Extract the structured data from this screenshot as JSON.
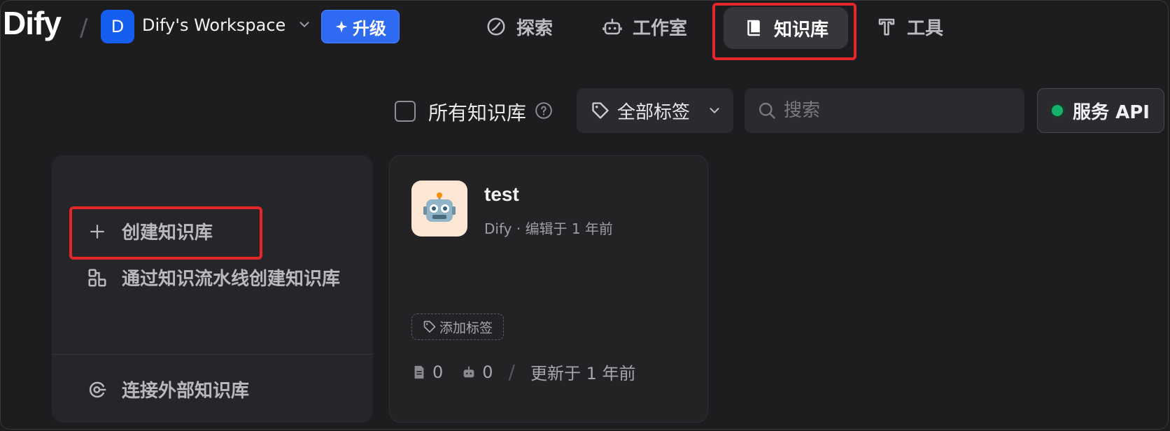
{
  "header": {
    "logo": "Dify",
    "separator": "/",
    "workspace_initial": "D",
    "workspace_name": "Dify's Workspace",
    "upgrade_label": "升级",
    "nav": {
      "explore": "探索",
      "studio": "工作室",
      "knowledge": "知识库",
      "tools": "工具"
    }
  },
  "toolbar": {
    "all_knowledge_label": "所有知识库",
    "tag_filter_label": "全部标签",
    "search_placeholder": "搜索",
    "service_api_label": "服务 API"
  },
  "create_card": {
    "create_label": "创建知识库",
    "pipeline_label": "通过知识流水线创建知识库",
    "external_label": "连接外部知识库"
  },
  "datasets": [
    {
      "name": "test",
      "author": "Dify",
      "edited": "编辑于 1 年前",
      "add_tag_label": "添加标签",
      "doc_count": "0",
      "app_count": "0",
      "updated": "更新于 1 年前"
    }
  ],
  "colors": {
    "accent": "#155eef",
    "highlight": "#e5272a",
    "api_status": "#17b26a"
  }
}
